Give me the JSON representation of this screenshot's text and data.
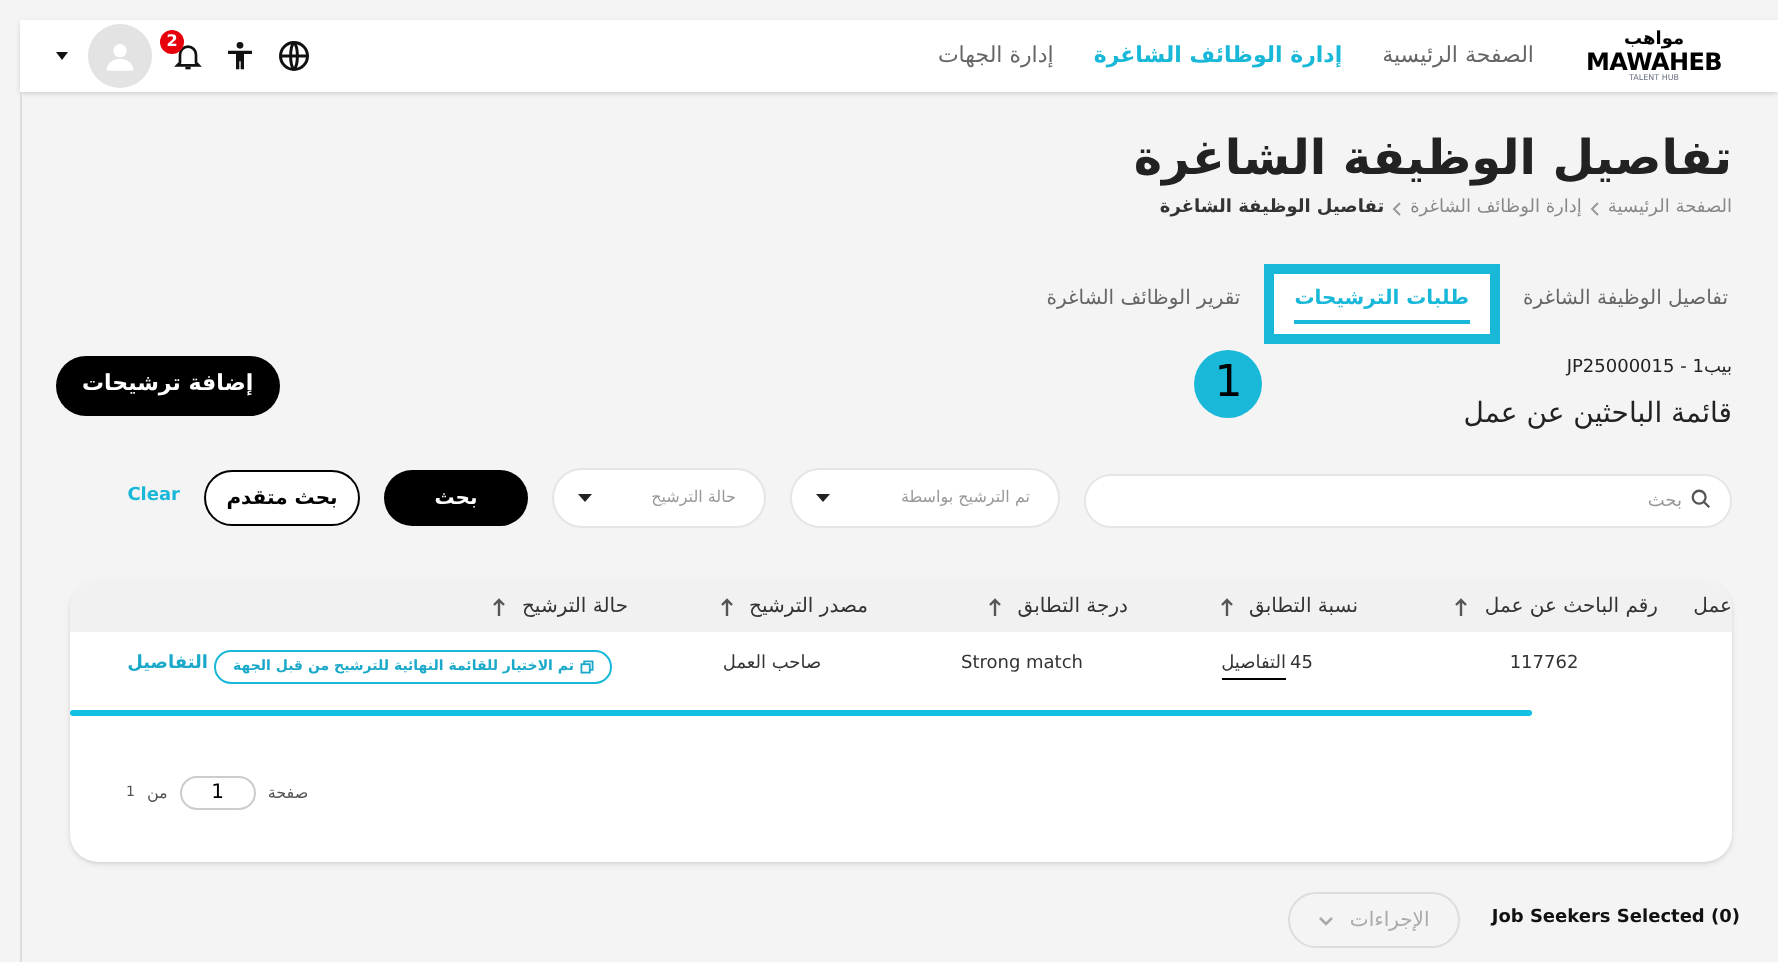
{
  "logo": {
    "arabic": "مواهب",
    "latin": "MAWAHEB",
    "tagline": "TALENT HUB"
  },
  "nav": [
    {
      "label": "الصفحة الرئيسية",
      "selected": false
    },
    {
      "label": "إدارة الوظائف الشاغرة",
      "selected": true
    },
    {
      "label": "إدارة الجهات",
      "selected": false
    }
  ],
  "notifications": {
    "count": "2"
  },
  "page": {
    "title": "تفاصيل الوظيفة الشاغرة",
    "breadcrumb": [
      {
        "label": "الصفحة الرئيسية",
        "current": false
      },
      {
        "label": "إدارة الوظائف الشاغرة",
        "current": false
      },
      {
        "label": "تفاصيل الوظيفة الشاغرة",
        "current": true
      }
    ]
  },
  "tabs": [
    {
      "label": "تفاصيل الوظيفة الشاغرة",
      "selected": false,
      "highlighted": false
    },
    {
      "label": "طلبات الترشيحات",
      "selected": true,
      "highlighted": true
    },
    {
      "label": "تقرير الوظائف الشاغرة",
      "selected": false,
      "highlighted": false
    }
  ],
  "callout": {
    "number": "1"
  },
  "job": {
    "reference": "بيب1 - JP25000015",
    "list_title": "قائمة الباحثين عن عمل"
  },
  "add_button": "إضافة ترشيحات",
  "filters": {
    "search": {
      "placeholder": "بحث"
    },
    "dropdowns": [
      {
        "placeholder": "تم الترشيح بواسطة"
      },
      {
        "placeholder": "حالة الترشيح"
      }
    ],
    "search_button": "بحث",
    "advanced_button": "بحث متقدم",
    "clear": "Clear"
  },
  "table": {
    "columns": [
      "عمل",
      "رقم الباحث عن عمل",
      "نسبة التطابق",
      "درجة التطابق",
      "مصدر الترشيح",
      "حالة الترشيح"
    ],
    "rows": [
      {
        "id": "117762",
        "match_percent": "45",
        "match_link": "التفاصيل",
        "match_level": "Strong match",
        "source": "صاحب العمل",
        "status": "تم الاختيار للقائمة النهائية للترشيح من قبل الجهة",
        "details": "التفاصيل"
      }
    ]
  },
  "pagination": {
    "page_label": "صفحة",
    "page": "1",
    "of_label": "من",
    "total": "1"
  },
  "footer": {
    "selected": "Job Seekers Selected (0)",
    "actions": {
      "label": "الإجراءات",
      "disabled": true
    }
  }
}
